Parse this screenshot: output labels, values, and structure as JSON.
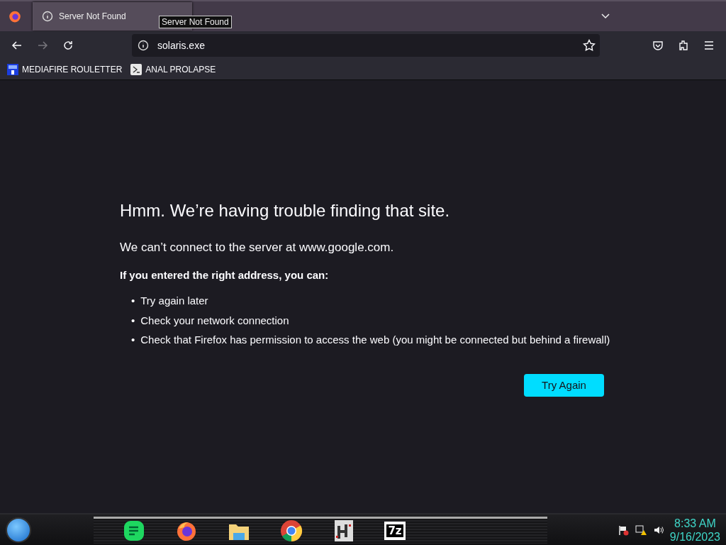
{
  "tabs": [
    {
      "title": "Server Not Found",
      "selected": true
    }
  ],
  "tooltip": "Server Not Found",
  "address": {
    "value": "solaris.exe"
  },
  "bookmarks": [
    {
      "kind": "mf",
      "label": "MEDIAFIRE ROULETTER"
    },
    {
      "kind": "terminal",
      "label": "ANAL PROLAPSE"
    }
  ],
  "error": {
    "title": "Hmm. We’re having trouble finding that site.",
    "message": "We can’t connect to the server at www.google.com.",
    "intro": "If you entered the right address, you can:",
    "bullet": "•",
    "tips": [
      "Try again later",
      "Check your network connection",
      "Check that Firefox has permission to access the web (you might be connected but behind a firewall)"
    ],
    "button": "Try Again"
  },
  "taskbar": {
    "apps": [
      {
        "kind": "notes"
      },
      {
        "kind": "firefox"
      },
      {
        "kind": "folder"
      },
      {
        "kind": "chrome"
      },
      {
        "kind": "maze"
      },
      {
        "kind": "archive",
        "label": "7z"
      }
    ],
    "time": "8:33 AM",
    "date": "9/16/2023"
  }
}
